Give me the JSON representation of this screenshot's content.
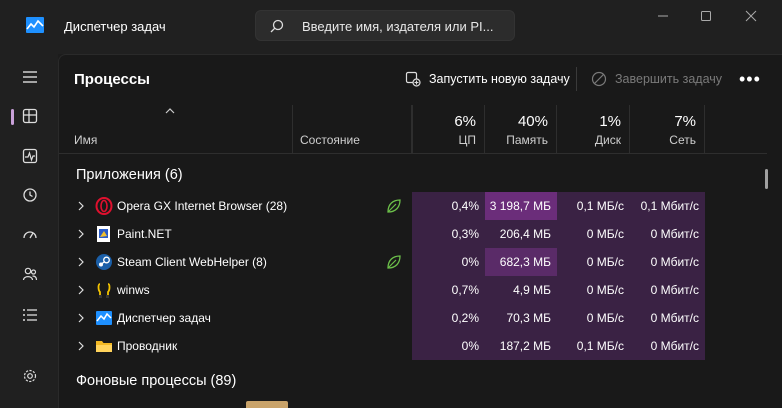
{
  "window": {
    "title": "Диспетчер задач",
    "search_placeholder": "Введите имя, издателя или PI..."
  },
  "nav": {
    "items": [
      "hamburger-menu",
      "processes",
      "performance",
      "app-history",
      "startup-apps",
      "users",
      "details",
      "settings"
    ],
    "active": "processes"
  },
  "toolbar": {
    "page_title": "Процессы",
    "run_new_task": "Запустить новую задачу",
    "end_task": "Завершить задачу",
    "more": "•••"
  },
  "columns": {
    "name": "Имя",
    "status": "Состояние",
    "cpu": {
      "pct": "6%",
      "label": "ЦП"
    },
    "memory": {
      "pct": "40%",
      "label": "Память"
    },
    "disk": {
      "pct": "1%",
      "label": "Диск"
    },
    "network": {
      "pct": "7%",
      "label": "Сеть"
    }
  },
  "groups": {
    "apps_title": "Приложения (6)",
    "background_title": "Фоновые процессы (89)"
  },
  "processes": [
    {
      "name": "Opera GX Internet Browser (28)",
      "icon": "opera-gx-icon",
      "efficiency": true,
      "cpu": "0,4%",
      "memory": "3 198,7 МБ",
      "disk": "0,1 МБ/с",
      "network": "0,1 Мбит/с"
    },
    {
      "name": "Paint.NET",
      "icon": "paint-net-icon",
      "efficiency": false,
      "cpu": "0,3%",
      "memory": "206,4 МБ",
      "disk": "0 МБ/с",
      "network": "0 Мбит/с"
    },
    {
      "name": "Steam Client WebHelper (8)",
      "icon": "steam-icon",
      "efficiency": true,
      "cpu": "0%",
      "memory": "682,3 МБ",
      "disk": "0 МБ/с",
      "network": "0 Мбит/с"
    },
    {
      "name": "winws",
      "icon": "winws-icon",
      "efficiency": false,
      "cpu": "0,7%",
      "memory": "4,9 МБ",
      "disk": "0 МБ/с",
      "network": "0 Мбит/с"
    },
    {
      "name": "Диспетчер задач",
      "icon": "task-manager-icon",
      "efficiency": false,
      "cpu": "0,2%",
      "memory": "70,3 МБ",
      "disk": "0 МБ/с",
      "network": "0 Мбит/с"
    },
    {
      "name": "Проводник",
      "icon": "file-explorer-icon",
      "efficiency": false,
      "cpu": "0%",
      "memory": "187,2 МБ",
      "disk": "0,1 МБ/с",
      "network": "0 Мбит/с"
    }
  ],
  "colors": {
    "accent": "#c8a0d8",
    "heat_low": "#3a2244",
    "heat_mid": "#4d2958",
    "heat_high": "#6b2d7a",
    "efficiency_leaf": "#6cc04a"
  }
}
